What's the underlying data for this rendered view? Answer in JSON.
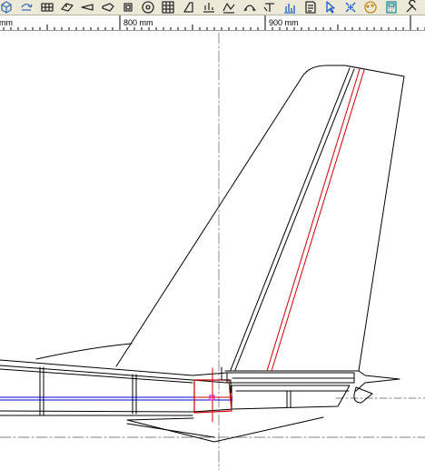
{
  "app": {
    "view": "side-elevation-drawing"
  },
  "toolbar": {
    "buttons": [
      {
        "name": "view-iso-icon",
        "color": "#3a6db5"
      },
      {
        "name": "view-rotate-icon",
        "color": "#3a6db5"
      },
      {
        "name": "wing-layout-icon",
        "color": "#2d2d2d"
      },
      {
        "name": "wing-3d-icon",
        "color": "#2d2d2d"
      },
      {
        "name": "fuselage-layout-icon",
        "color": "#2d2d2d"
      },
      {
        "name": "fuselage-3d-icon",
        "color": "#2d2d2d"
      },
      {
        "name": "engine-icon",
        "color": "#2d2d2d"
      },
      {
        "name": "wheel-icon",
        "color": "#2d2d2d"
      },
      {
        "name": "grid-icon",
        "color": "#2d2d2d"
      },
      {
        "name": "tail-icon",
        "color": "#2d2d2d"
      },
      {
        "name": "chart-icon",
        "color": "#2d2d2d"
      },
      {
        "name": "view-3d-icon",
        "color": "#2d2d2d"
      },
      {
        "name": "arc-3d-icon",
        "color": "#2d2d2d"
      },
      {
        "name": "text-3d-icon",
        "color": "#2d2d2d"
      },
      {
        "name": "bar-chart-icon",
        "color": "#1a5fcc"
      },
      {
        "name": "print-preview-icon",
        "color": "#2d2d2d"
      },
      {
        "name": "pointer-icon",
        "color": "#1a5fcc"
      },
      {
        "name": "move-nodes-icon",
        "color": "#1a5fcc"
      },
      {
        "name": "palette-icon",
        "color": "#c08a1e"
      },
      {
        "name": "calculator-icon",
        "color": "#1a8f9a"
      },
      {
        "name": "tools-icon",
        "color": "#2d2d2d"
      }
    ]
  },
  "ruler": {
    "labels": [
      {
        "text": "mm"
      },
      {
        "text": "800 mm"
      },
      {
        "text": "900 mm"
      }
    ]
  },
  "drawing": {
    "colors": {
      "outline": "#000000",
      "spar": "#cc0000",
      "centerline": "#808080",
      "pushrod": "#0000cc",
      "selection": "#cc0000",
      "marker": "#cc00cc"
    }
  }
}
